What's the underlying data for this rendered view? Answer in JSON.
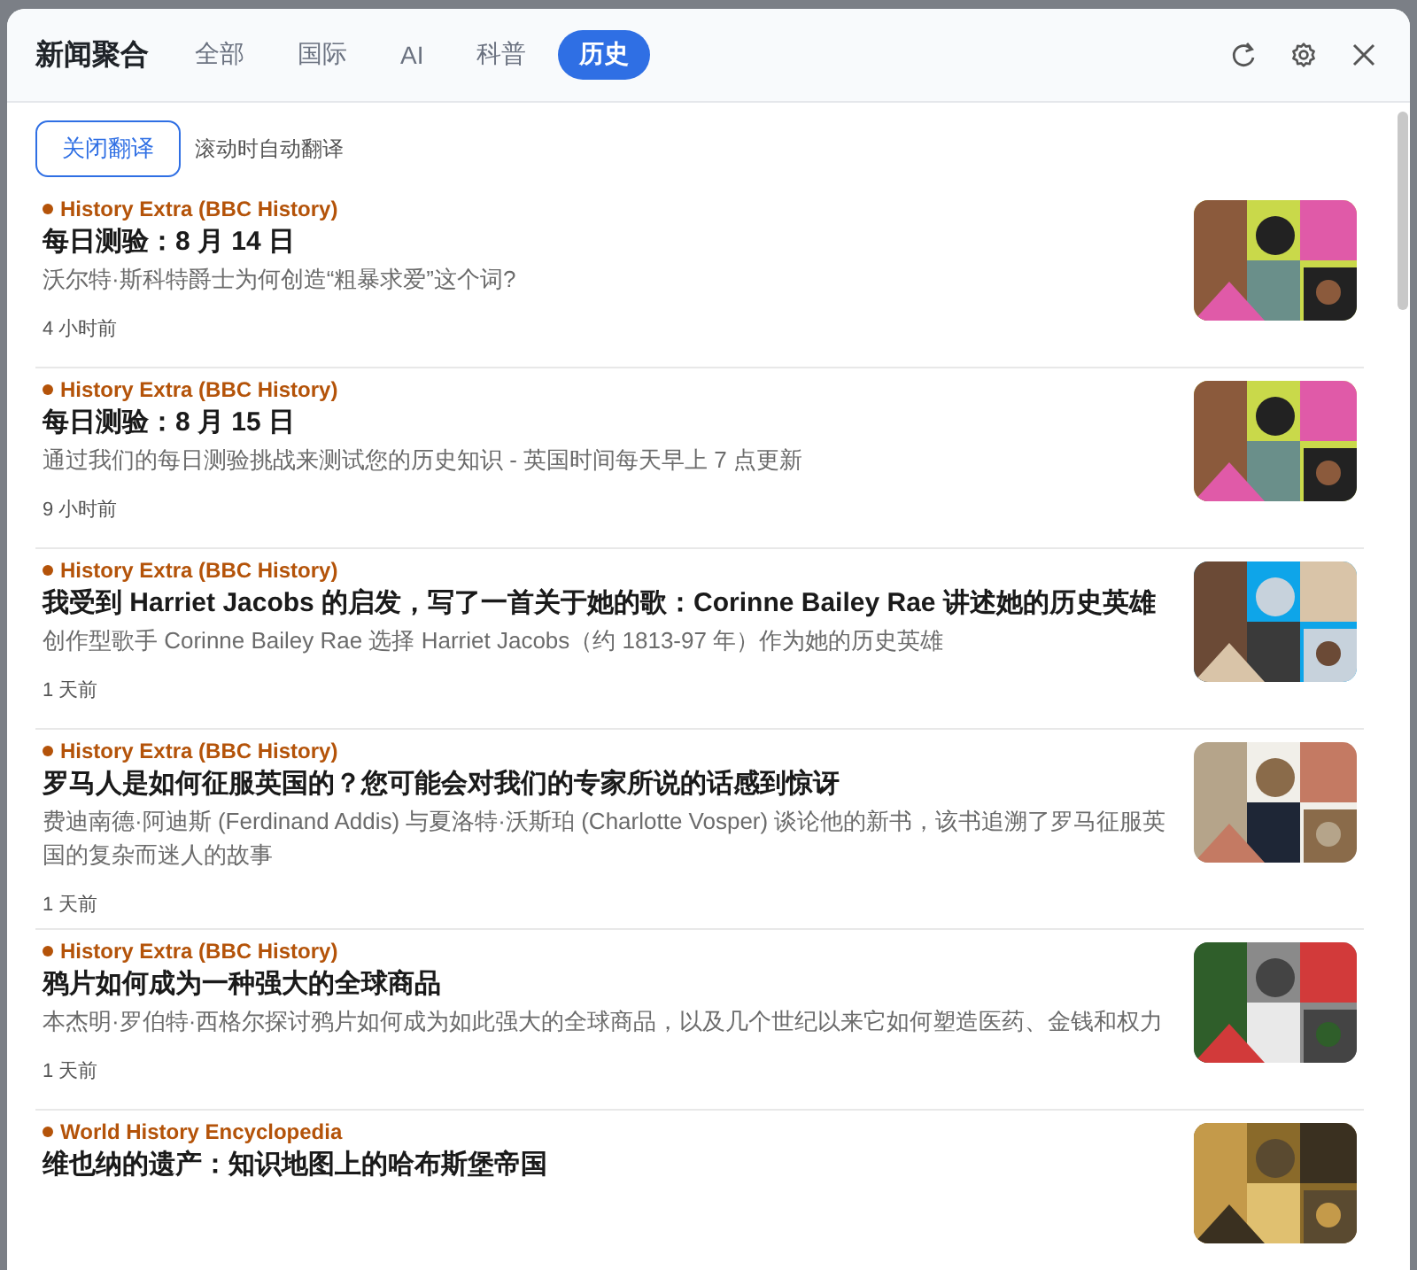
{
  "app": {
    "title": "新闻聚合"
  },
  "tabs": [
    {
      "label": "全部",
      "selected": false
    },
    {
      "label": "国际",
      "selected": false
    },
    {
      "label": "AI",
      "selected": false
    },
    {
      "label": "科普",
      "selected": false
    },
    {
      "label": "历史",
      "selected": true
    }
  ],
  "translate": {
    "button": "关闭翻译",
    "hint": "滚动时自动翻译"
  },
  "articles": [
    {
      "source": "History Extra (BBC History)",
      "title": "每日测验：8 月 14 日",
      "summary": "沃尔特·斯科特爵士为何创造“粗暴求爱”这个词?",
      "time": "4 小时前"
    },
    {
      "source": "History Extra (BBC History)",
      "title": "每日测验：8 月 15 日",
      "summary": "通过我们的每日测验挑战来测试您的历史知识 - 英国时间每天早上 7 点更新",
      "time": "9 小时前"
    },
    {
      "source": "History Extra (BBC History)",
      "title": "我受到 Harriet Jacobs 的启发，写了一首关于她的歌：Corinne Bailey Rae 讲述她的历史英雄",
      "summary": "创作型歌手 Corinne Bailey Rae 选择 Harriet Jacobs（约 1813-97 年）作为她的历史英雄",
      "time": "1 天前"
    },
    {
      "source": "History Extra (BBC History)",
      "title": "罗马人是如何征服英国的？您可能会对我们的专家所说的话感到惊讶",
      "summary": "费迪南德·阿迪斯 (Ferdinand Addis) 与夏洛特·沃斯珀 (Charlotte Vosper) 谈论他的新书，该书追溯了罗马征服英国的复杂而迷人的故事",
      "time": "1 天前"
    },
    {
      "source": "History Extra (BBC History)",
      "title": "鸦片如何成为一种强大的全球商品",
      "summary": "本杰明·罗伯特·西格尔探讨鸦片如何成为如此强大的全球商品，以及几个世纪以来它如何塑造医药、金钱和权力",
      "time": "1 天前"
    },
    {
      "source": "World History Encyclopedia",
      "title": "维也纳的遗产：知识地图上的哈布斯堡帝国"
    }
  ]
}
